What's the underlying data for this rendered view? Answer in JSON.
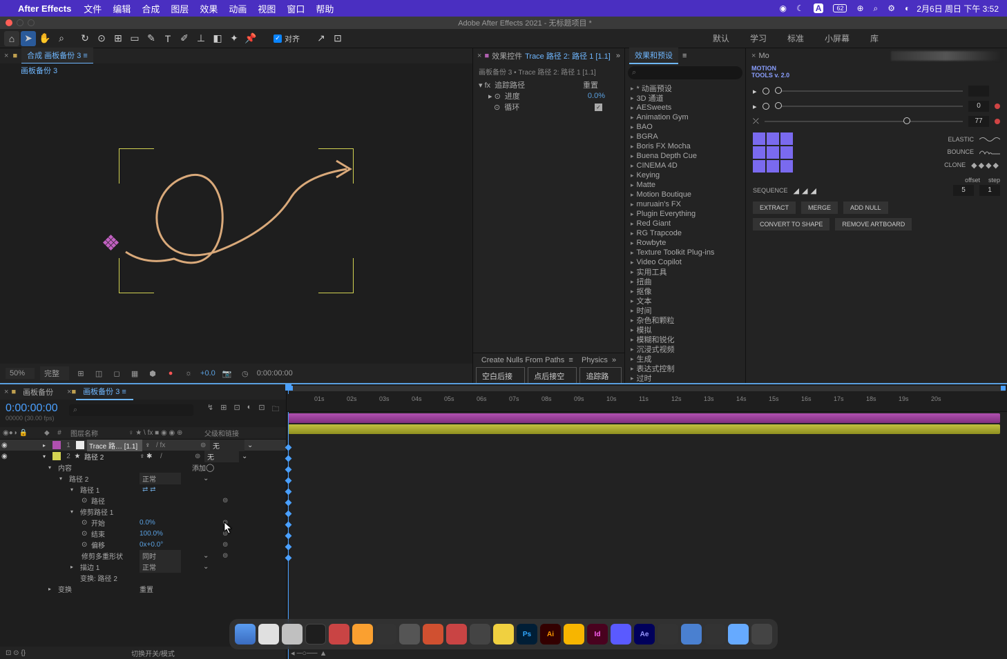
{
  "menubar": {
    "app": "After Effects",
    "items": [
      "文件",
      "编辑",
      "合成",
      "图层",
      "效果",
      "动画",
      "视图",
      "窗口",
      "帮助"
    ],
    "clock": "2月6日 周日 下午 3:52"
  },
  "window_title": "Adobe After Effects 2021 - 无标题项目 *",
  "toolbar": {
    "snap_label": "对齐",
    "workspaces": [
      "默认",
      "学习",
      "标准",
      "小屏幕",
      "库"
    ]
  },
  "comp_panel": {
    "tab_label": "合成 画板备份 3",
    "comp_name": "画板备份 3"
  },
  "viewer_bar": {
    "zoom": "50%",
    "quality": "完整",
    "exposure": "+0.0",
    "timecode": "0:00:00:00"
  },
  "effect_controls": {
    "tab_prefix": "效果控件",
    "tab_layer": "Trace 路径 2: 路径 1 [1.1]",
    "breadcrumb": "画板备份 3 • Trace 路径 2: 路径 1 [1.1]",
    "effect_name": "追踪路径",
    "reset": "重置",
    "progress_label": "进度",
    "progress_value": "0.0%",
    "loop_label": "循环"
  },
  "script_panel": {
    "title": "Create Nulls From Paths",
    "title2": "Physics",
    "btn1": "空白后接点",
    "btn2": "点后接空白",
    "btn3": "追踪路径"
  },
  "presets": {
    "title": "效果和预设",
    "search_placeholder": "",
    "items": [
      "* 动画预设",
      "3D 通道",
      "AESweets",
      "Animation Gym",
      "BAO",
      "BGRA",
      "Boris FX Mocha",
      "Buena Depth Cue",
      "CINEMA 4D",
      "Keying",
      "Matte",
      "Motion Boutique",
      "muruain's FX",
      "Plugin Everything",
      "Red Giant",
      "RG Trapcode",
      "Rowbyte",
      "Texture Toolkit Plug-ins",
      "Video Copilot",
      "实用工具",
      "扭曲",
      "抠像",
      "文本",
      "时间",
      "杂色和颗粒",
      "模拟",
      "模糊和锐化",
      "沉浸式视频",
      "生成",
      "表达式控制",
      "过时"
    ]
  },
  "motion_tools": {
    "tab": "Mo",
    "title": "MOTION\nTOOLS v. 2.0",
    "val0": "0",
    "val77": "77",
    "elastic": "ELASTIC",
    "bounce": "BOUNCE",
    "clone": "CLONE",
    "offset": "offset",
    "step": "step",
    "sequence": "SEQUENCE",
    "seq_val": "5",
    "step_val": "1",
    "extract": "EXTRACT",
    "merge": "MERGE",
    "addnull": "ADD NULL",
    "convert": "CONVERT TO SHAPE",
    "remove": "REMOVE ARTBOARD"
  },
  "timeline": {
    "tabs": [
      "画板备份",
      "画板备份 3"
    ],
    "timecode": "0:00:00:00",
    "frames": "00000 (30.00 fps)",
    "search_placeholder": "",
    "col_index": "#",
    "col_name": "图层名称",
    "col_switches": "♀ ★ \\ fx ■ ◉ ◉ ⊕",
    "col_parent": "父级和链接",
    "layer1": {
      "num": "1",
      "name": "Trace 路… [1.1]",
      "parent": "无"
    },
    "layer2": {
      "num": "2",
      "name": "路径 2",
      "parent": "无"
    },
    "props": {
      "contents": "内容",
      "add": "添加",
      "path2": "路径 2",
      "normal1": "正常",
      "path1": "路径 1",
      "path": "路径",
      "trim": "修剪路径 1",
      "start": "开始",
      "start_val": "0.0%",
      "end": "结束",
      "end_val": "100.0%",
      "offset": "偏移",
      "offset_val": "0x+0.0°",
      "trimMulti": "修剪多重形状",
      "trimMulti_val": "同时",
      "stroke": "描边 1",
      "normal2": "正常",
      "transform_path": "变换: 路径 2",
      "transform": "变换",
      "reset": "重置"
    },
    "toggle_label": "切换开关/模式",
    "ruler_ticks": [
      "01s",
      "02s",
      "03s",
      "04s",
      "05s",
      "06s",
      "07s",
      "08s",
      "09s",
      "10s",
      "11s",
      "12s",
      "13s",
      "14s",
      "15s",
      "16s",
      "17s",
      "18s",
      "19s",
      "20s"
    ]
  }
}
